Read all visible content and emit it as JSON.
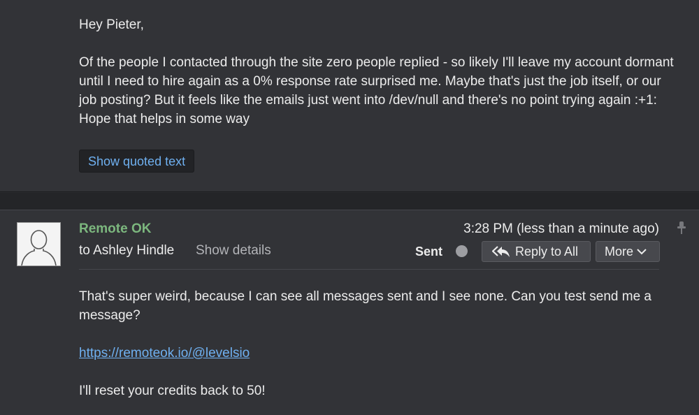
{
  "previous_message": {
    "greeting": "Hey Pieter,",
    "paragraph": "Of the people I contacted through the site zero people replied - so likely I'll leave my account dormant until I need to hire again as a 0% response rate surprised me.  Maybe that's just the job itself, or our job posting?  But it feels like the emails just went into /dev/null and there's no point trying again :+1: Hope that helps in some way",
    "show_quoted_label": "Show quoted text"
  },
  "current_message": {
    "sender": "Remote OK",
    "recipient": "to Ashley Hindle",
    "show_details_label": "Show details",
    "timestamp": "3:28 PM (less than a minute ago)",
    "status": "Sent",
    "reply_all_label": "Reply to All",
    "more_label": "More",
    "body_line1": "That's super weird, because I can see all messages sent and I see none. Can you test send me a message?",
    "link": "https://remoteok.io/@levelsio",
    "closing": "I'll reset your credits back to 50!"
  },
  "colors": {
    "sender": "#7cb77e",
    "link": "#6fb0f0",
    "background": "#323337"
  },
  "icons": {
    "avatar": "default-user-silhouette",
    "pin": "pin-icon",
    "reply_all": "reply-all-icon",
    "more": "chevron-down-icon"
  }
}
